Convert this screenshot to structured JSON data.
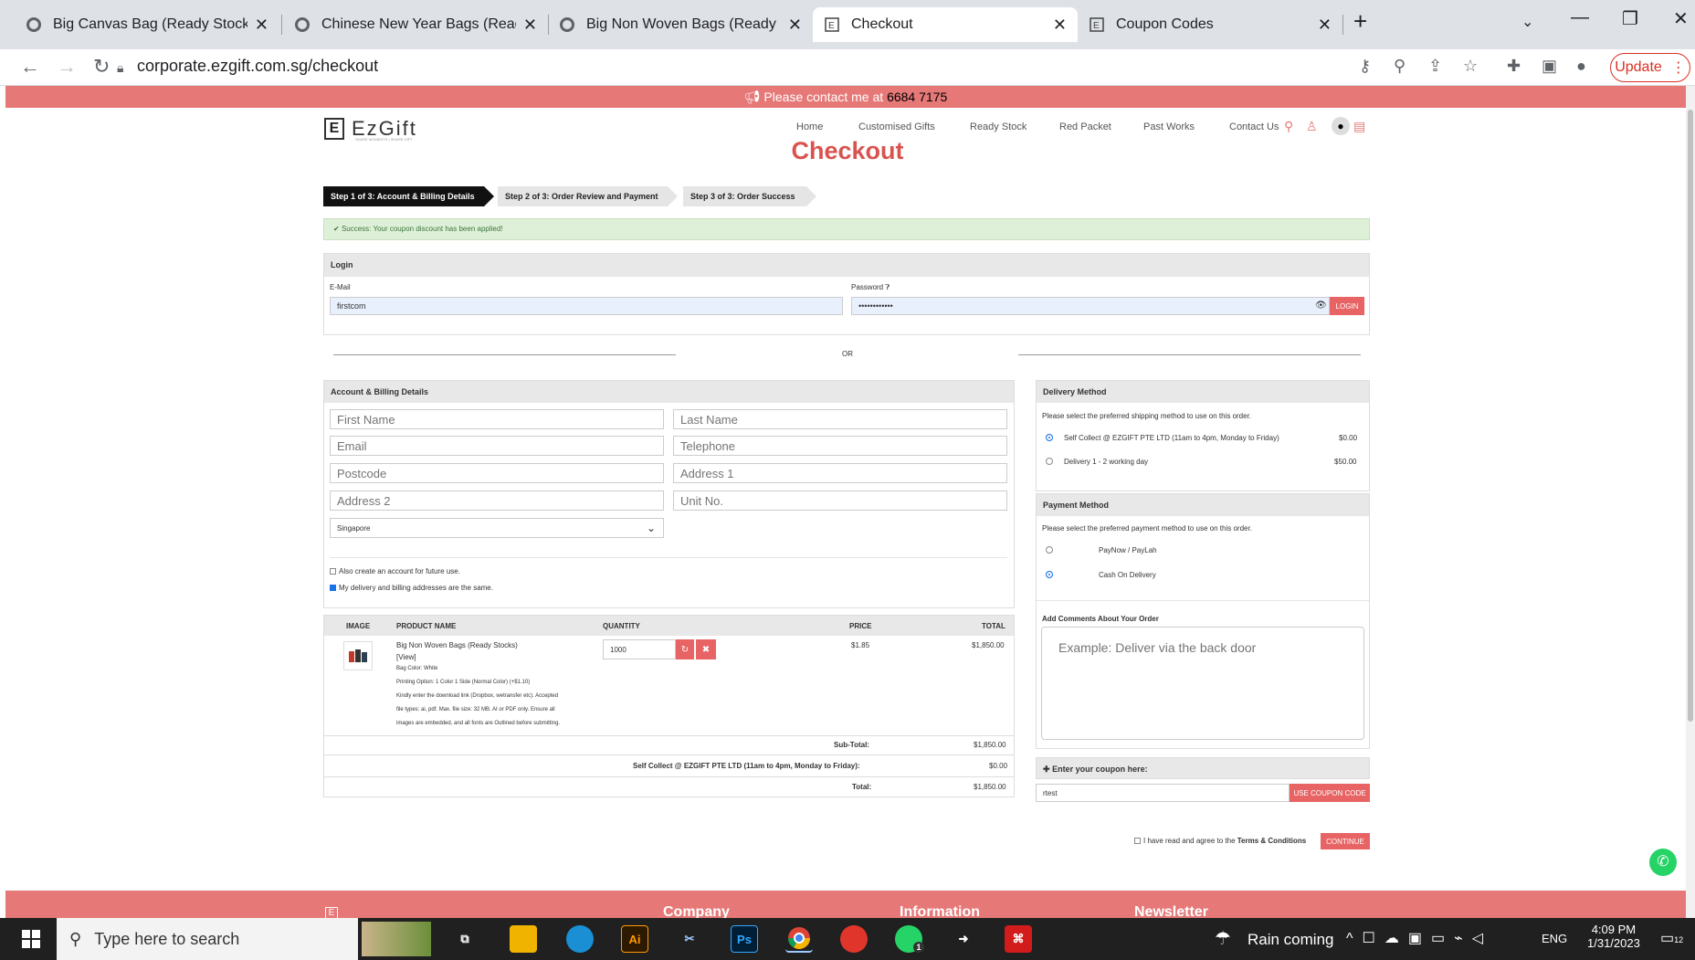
{
  "browser": {
    "tabs": [
      {
        "title": "Big Canvas Bag (Ready Stocks)"
      },
      {
        "title": "Chinese New Year Bags (Ready st"
      },
      {
        "title": "Big Non Woven Bags (Ready Stoc"
      },
      {
        "title": "Checkout"
      },
      {
        "title": "Coupon Codes"
      }
    ],
    "new_tab": "+",
    "url": "corporate.ezgift.com.sg/checkout",
    "update_label": "Update"
  },
  "site": {
    "topbar_text": "Please contact me at",
    "topbar_phone": "6684 7175",
    "logo_text": "EzGift",
    "logo_tagline": "SHARE MOMENTS | SHARE GIFT",
    "nav": [
      "Home",
      "Customised Gifts",
      "Ready Stock",
      "Red Packet",
      "Past Works",
      "Contact Us"
    ],
    "page_title": "Checkout"
  },
  "steps": [
    "Step 1 of 3: Account & Billing Details",
    "Step 2 of 3: Order Review and Payment",
    "Step 3 of 3: Order Success"
  ],
  "alert": "Success: Your coupon discount has been applied!",
  "login": {
    "heading": "Login",
    "email_label": "E-Mail",
    "email_value": "firstcom",
    "password_label": "Password",
    "password_value": "••••••••••••",
    "login_button": "LOGIN",
    "or_label": "OR"
  },
  "billing": {
    "heading": "Account & Billing Details",
    "placeholders": {
      "first_name": "First Name",
      "last_name": "Last Name",
      "email": "Email",
      "telephone": "Telephone",
      "postcode": "Postcode",
      "address1": "Address 1",
      "address2": "Address 2",
      "unit": "Unit No."
    },
    "country": "Singapore",
    "create_account": "Also create an account for future use.",
    "same_address": "My delivery and billing addresses are the same."
  },
  "cart": {
    "headers": [
      "IMAGE",
      "PRODUCT NAME",
      "QUANTITY",
      "PRICE",
      "TOTAL"
    ],
    "item": {
      "name": "Big Non Woven Bags (Ready Stocks)",
      "view": "[View]",
      "color": "Bag Color: White",
      "printing": "Printing Option: 1 Color 1 Side (Normal Color) (+$1.10)",
      "note1": "Kindly enter the download link (Dropbox, wetransfer etc). Accepted",
      "note2": "file types: ai, pdf. Max. file size: 32 MB. AI or PDF only. Ensure all",
      "note3": "images are embedded, and all fonts are Outlined before submitting.",
      "quantity": "1000",
      "price": "$1.85",
      "total": "$1,850.00"
    },
    "subtotal_label": "Sub-Total:",
    "subtotal": "$1,850.00",
    "shipping_label": "Self Collect @ EZGIFT PTE LTD (11am to 4pm, Monday to Friday):",
    "shipping": "$0.00",
    "total_label": "Total:",
    "total": "$1,850.00"
  },
  "delivery": {
    "heading": "Delivery Method",
    "prompt": "Please select the preferred shipping method to use on this order.",
    "options": [
      {
        "label": "Self Collect @ EZGIFT PTE LTD (11am to 4pm, Monday to Friday)",
        "price": "$0.00",
        "selected": true
      },
      {
        "label": "Delivery 1 - 2 working day",
        "price": "$50.00",
        "selected": false
      }
    ]
  },
  "payment": {
    "heading": "Payment Method",
    "prompt": "Please select the preferred payment method to use on this order.",
    "options": [
      {
        "label": "PayNow / PayLah",
        "selected": false
      },
      {
        "label": "Cash On Delivery",
        "selected": true
      }
    ]
  },
  "comments": {
    "heading": "Add Comments About Your Order",
    "placeholder": "Example: Deliver via the back door"
  },
  "coupon": {
    "heading": "Enter your coupon here:",
    "value": "rtest",
    "button": "USE COUPON CODE"
  },
  "terms": {
    "text": "I have read and agree to the",
    "link": "Terms & Conditions",
    "button": "CONTINUE"
  },
  "footer": {
    "company": "Company",
    "information": "Information",
    "newsletter": "Newsletter"
  },
  "taskbar": {
    "search_placeholder": "Type here to search",
    "weather": "Rain coming",
    "lang": "ENG",
    "time": "4:09 PM",
    "date": "1/31/2023",
    "notifications": "12",
    "whatsapp_badge": "1",
    "apps": [
      "Ai",
      "Ps"
    ]
  },
  "colors": {
    "accent": "#e67878",
    "title_red": "#d9534f",
    "success_bg": "#dff0d8",
    "taskbar": "#202020"
  }
}
